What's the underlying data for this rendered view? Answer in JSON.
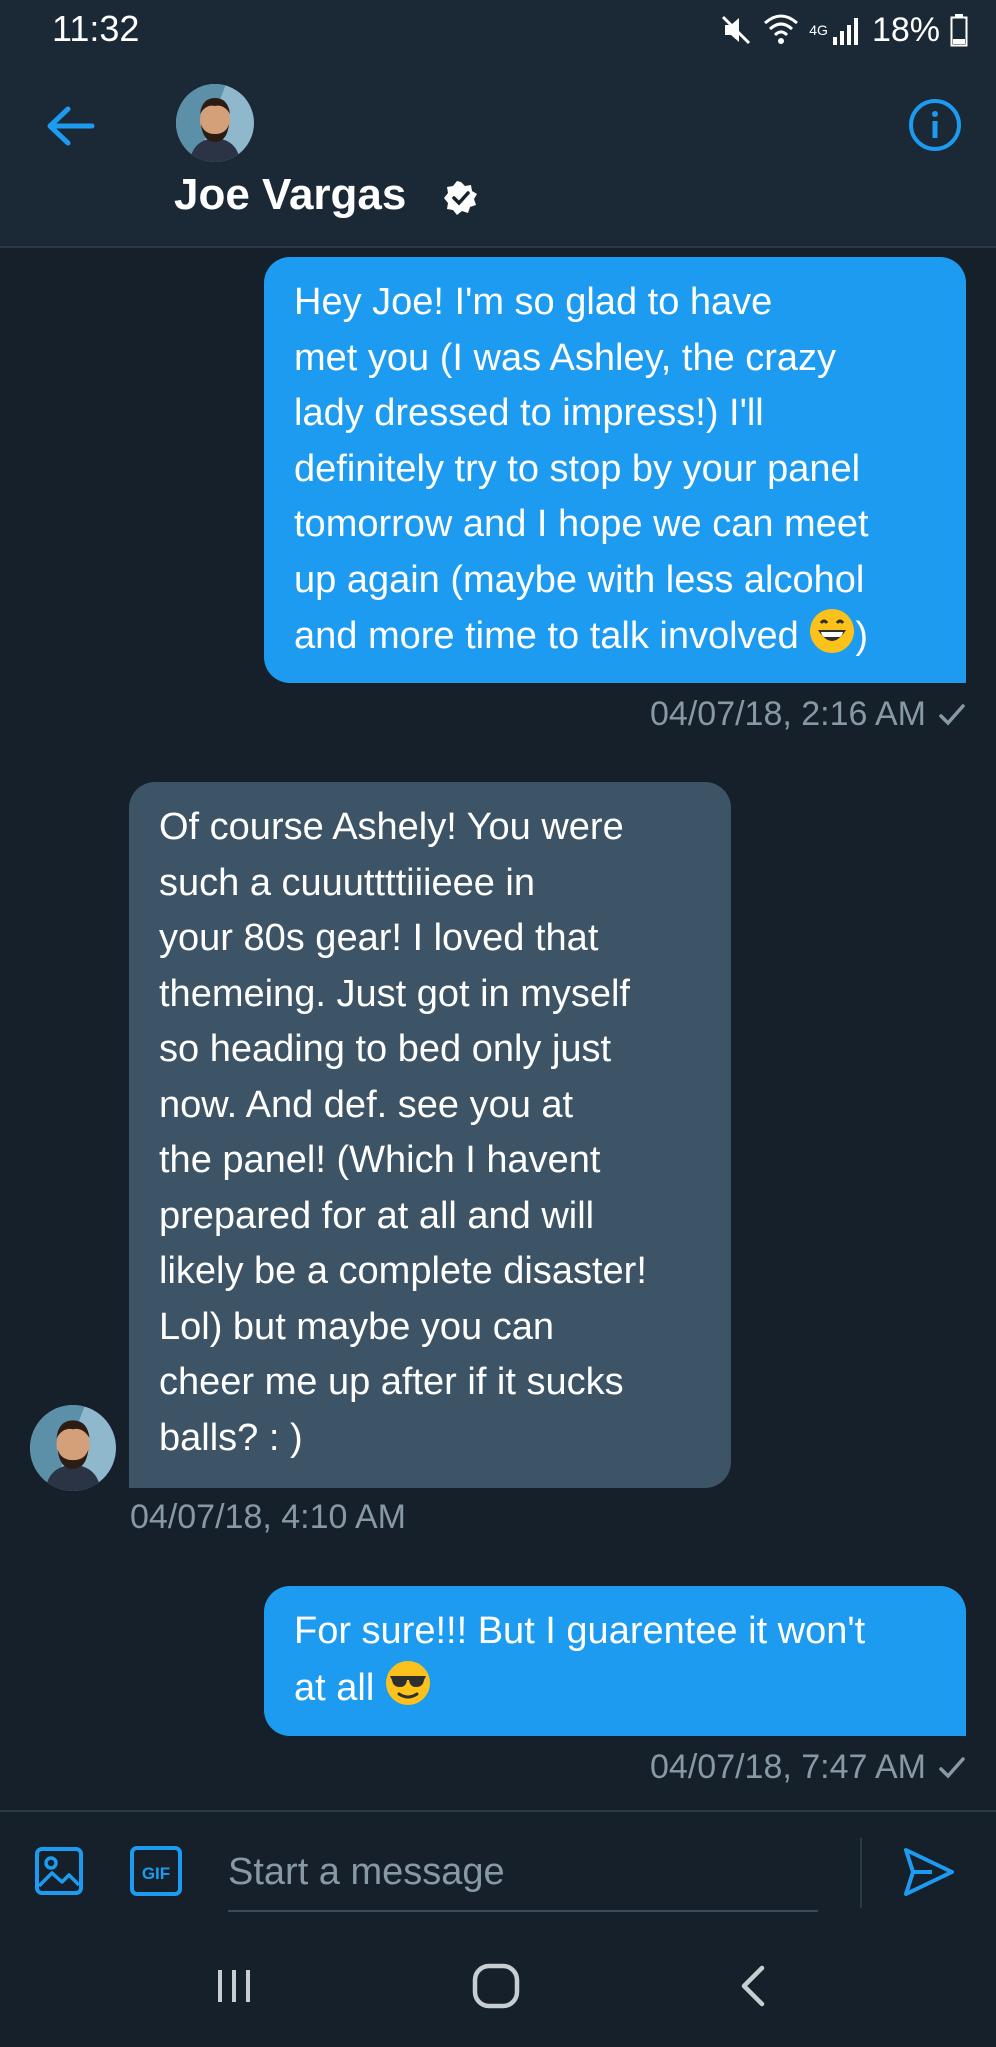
{
  "status_bar": {
    "time": "11:32",
    "network": "4G",
    "battery": "18%"
  },
  "header": {
    "contact_name": "Joe Vargas",
    "verified": true,
    "icons": {
      "back": "arrow-left-icon",
      "info": "info-circle-icon",
      "verified": "verified-badge-icon"
    }
  },
  "messages": [
    {
      "direction": "outgoing",
      "lines": [
        "Hey Joe! I'm so glad to have",
        "met you (I was Ashley, the crazy",
        "lady dressed to impress!) I'll",
        "definitely try to stop by your panel",
        "tomorrow and I hope we can meet",
        "up again (maybe with less alcohol",
        "and more time to talk involved",
        ")"
      ],
      "emoji": "grinning-face-emoji",
      "timestamp": "04/07/18, 2:16 AM",
      "read_check": true
    },
    {
      "direction": "incoming",
      "lines": [
        "Of course Ashely! You were",
        "such a cuuuttttiiieee in",
        "your 80s gear! I loved that",
        "themeing. Just got in myself",
        "so heading to bed only just",
        "now. And def. see you at",
        "the panel! (Which I havent",
        "prepared for at all and will",
        "likely be a complete disaster!",
        "Lol) but maybe you can",
        "cheer me up after if it sucks",
        "balls? : )"
      ],
      "timestamp": "04/07/18, 4:10 AM"
    },
    {
      "direction": "outgoing",
      "lines": [
        "For sure!!! But I guarentee it won't",
        "at all"
      ],
      "emoji": "sunglasses-face-emoji",
      "timestamp": "04/07/18, 7:47 AM",
      "read_check": true
    }
  ],
  "composer": {
    "placeholder": "Start a message",
    "gif_label": "GIF",
    "icons": {
      "media": "image-icon",
      "gif": "gif-icon",
      "send": "send-icon"
    }
  },
  "colors": {
    "background": "#15202b",
    "header_bg": "#1b2836",
    "outgoing_bubble": "#1d9bf0",
    "incoming_bubble": "#3d5466",
    "accent": "#1d9bf0",
    "meta_text": "#8899a6"
  },
  "nav_bar": {
    "icons": [
      "recents-icon",
      "home-icon",
      "back-chevron-icon"
    ]
  }
}
